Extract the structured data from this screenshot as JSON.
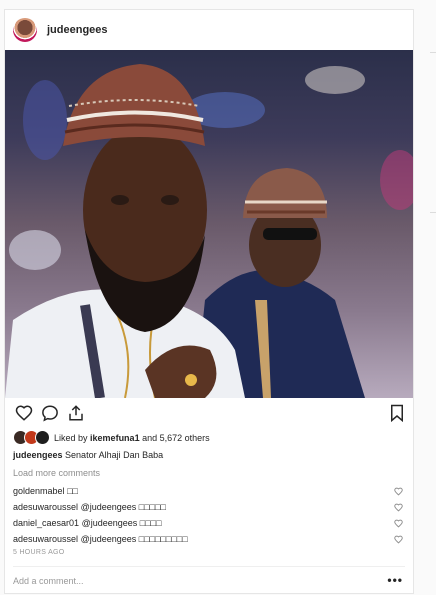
{
  "post": {
    "username": "judeengees",
    "likes": {
      "prefix": "Liked by",
      "user": "ikemefuna1",
      "suffix": "and 5,672 others"
    },
    "caption": {
      "user": "judeengees",
      "text": "Senator Alhaji Dan Baba"
    },
    "load_more": "Load more comments",
    "comments": [
      {
        "user": "goldenmabel",
        "text": "□□"
      },
      {
        "user": "adesuwaroussel",
        "text": "@judeengees □□□□□"
      },
      {
        "user": "daniel_caesar01",
        "text": "@judeengees □□□□"
      },
      {
        "user": "adesuwaroussel",
        "text": "@judeengees □□□□□□□□□"
      }
    ],
    "timestamp": "5 HOURS AGO",
    "add_comment_placeholder": "Add a comment...",
    "more_options": "•••"
  },
  "icons": [
    "heart-icon",
    "comment-icon",
    "share-icon",
    "bookmark-icon",
    "more-options-icon"
  ],
  "colors": {
    "text": "#262626",
    "muted": "#8e8e8e",
    "border": "#e6e6e6"
  }
}
